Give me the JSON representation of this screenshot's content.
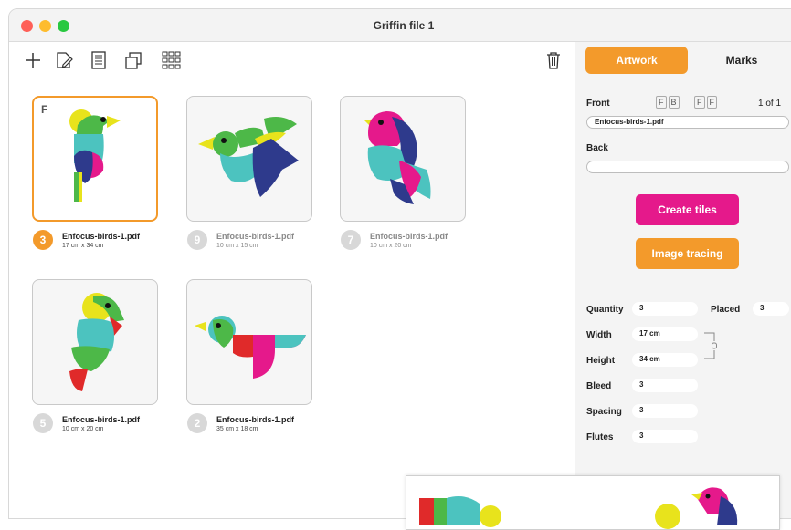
{
  "window": {
    "title": "Griffin file 1"
  },
  "toolbar": {
    "icons": [
      "add-icon",
      "edit-document-icon",
      "document-list-icon",
      "duplicate-icon",
      "grid-icon",
      "trash-icon"
    ]
  },
  "tabs": {
    "artwork": "Artwork",
    "marks": "Marks"
  },
  "artworks": [
    {
      "name": "Enfocus-birds-1.pdf",
      "size": "17 cm x 34 cm",
      "count": "3",
      "face": "F",
      "selected": true
    },
    {
      "name": "Enfocus-birds-1.pdf",
      "size": "10 cm x 15 cm",
      "count": "9",
      "face": "",
      "selected": false
    },
    {
      "name": "Enfocus-birds-1.pdf",
      "size": "10 cm x 20 cm",
      "count": "7",
      "face": "",
      "selected": false
    },
    {
      "name": "Enfocus-birds-1.pdf",
      "size": "10 cm x 20 cm",
      "count": "5",
      "face": "",
      "selected": false
    },
    {
      "name": "Enfocus-birds-1.pdf",
      "size": "35 cm x 18 cm",
      "count": "2",
      "face": "",
      "selected": false
    }
  ],
  "panel": {
    "front_label": "Front",
    "front_toggle_1": [
      "F",
      "B"
    ],
    "front_toggle_2": [
      "F",
      "F"
    ],
    "page_indicator": "1 of 1",
    "front_file": "Enfocus-birds-1.pdf",
    "back_label": "Back",
    "back_file": "",
    "create_tiles": "Create tiles",
    "image_tracing": "Image tracing",
    "quantity_label": "Quantity",
    "quantity_value": "3",
    "placed_label": "Placed",
    "placed_value": "3",
    "width_label": "Width",
    "width_value": "17 cm",
    "height_label": "Height",
    "height_value": "34 cm",
    "bleed_label": "Bleed",
    "bleed_value": "3",
    "spacing_label": "Spacing",
    "spacing_value": "3",
    "flutes_label": "Flutes",
    "flutes_value": "3"
  },
  "colors": {
    "accent_orange": "#f39a2b",
    "accent_pink": "#e5198b",
    "bird_blue": "#2e3a8c",
    "bird_teal": "#4cc3bf",
    "bird_green": "#4db848",
    "bird_yellow": "#e8e31c",
    "bird_red": "#e02a2a"
  }
}
